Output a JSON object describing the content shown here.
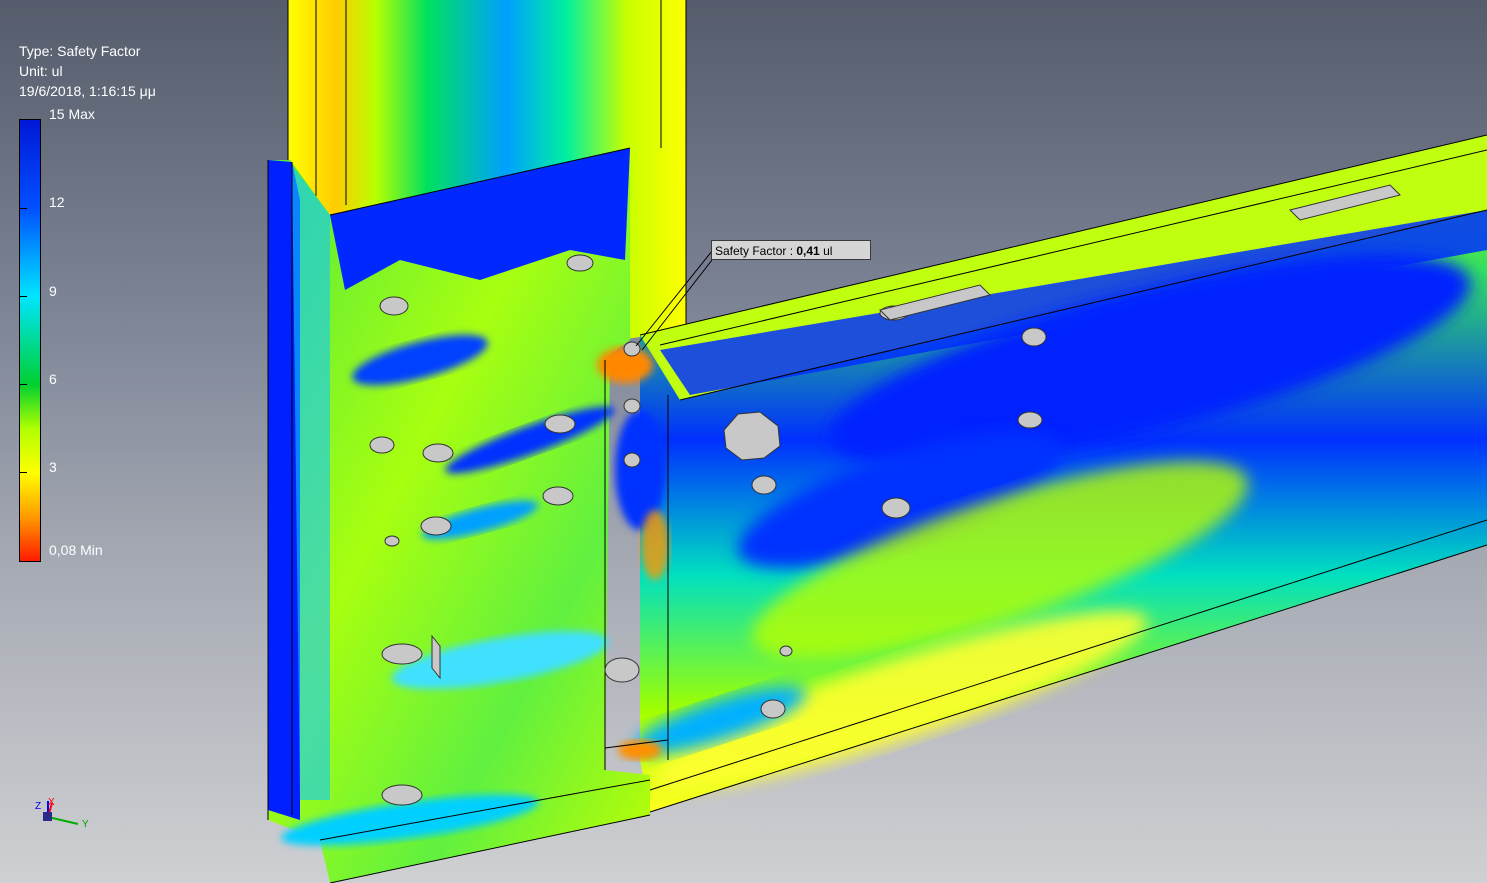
{
  "legend": {
    "type_line": "Type: Safety Factor",
    "unit_line": "Unit: ul",
    "date_line": "19/6/2018, 1:16:15 μμ",
    "scale": {
      "max_label": "15 Max",
      "ticks": [
        "12",
        "9",
        "6",
        "3"
      ],
      "min_label": "0,08 Min"
    }
  },
  "probe": {
    "label_prefix": "Safety Factor : ",
    "value": "0,41",
    "unit": " ul"
  },
  "triad": {
    "x": "X",
    "y": "Y",
    "z": "Z"
  },
  "colors": {
    "max": "#0018d8",
    "high": "#00e5ff",
    "mid": "#00d030",
    "low": "#ffff00",
    "warn": "#ff9a00",
    "min": "#ff1a00",
    "background_top": "#555c6b",
    "background_bottom": "#cfd0d3"
  }
}
